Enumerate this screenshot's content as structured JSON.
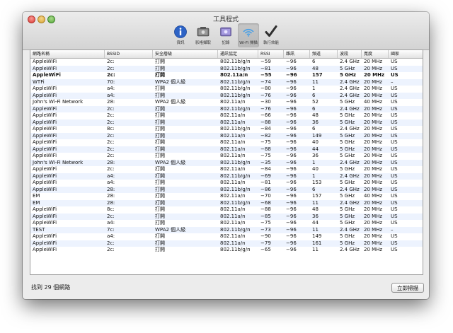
{
  "window": {
    "title": "工具程式"
  },
  "toolbar": {
    "items": [
      {
        "key": "info",
        "label": "資訊",
        "icon": "info-icon"
      },
      {
        "key": "sniffer",
        "label": "影格擷取",
        "icon": "frame-capture-icon"
      },
      {
        "key": "log",
        "label": "記錄",
        "icon": "log-icon"
      },
      {
        "key": "scan",
        "label": "Wi-Fi 掃描",
        "icon": "wifi-scan-icon",
        "selected": true
      },
      {
        "key": "performance",
        "label": "執行效能",
        "icon": "performance-check-icon"
      }
    ]
  },
  "table": {
    "columns": [
      "網路名稱",
      "BSSID",
      "安全層級",
      "通訊協定",
      "RSSI",
      "雜訊",
      "頻道",
      "波段",
      "寬度",
      "國家"
    ],
    "rows": [
      [
        "AppleWiFi",
        "2c:",
        "打開",
        "802.11b/g/n",
        "−59",
        "−96",
        "6",
        "2.4 GHz",
        "20 MHz",
        "US"
      ],
      [
        "AppleWiFi",
        "2c:",
        "打開",
        "802.11b/g/n",
        "−81",
        "−96",
        "48",
        "5 GHz",
        "20 MHz",
        "US"
      ],
      [
        "AppleWiFi",
        "2c:",
        "打開",
        "802.11a/n",
        "−55",
        "−96",
        "157",
        "5 GHz",
        "20 MHz",
        "US"
      ],
      [
        "WTFi",
        "70:",
        "WPA2 個人級",
        "802.11b/g/n",
        "−74",
        "−96",
        "11",
        "2.4 GHz",
        "20 MHz",
        "–"
      ],
      [
        "AppleWiFi",
        "a4:",
        "打開",
        "802.11b/g/n",
        "−80",
        "−96",
        "1",
        "2.4 GHz",
        "20 MHz",
        "US"
      ],
      [
        "AppleWiFi",
        "a4:",
        "打開",
        "802.11b/g/n",
        "−76",
        "−96",
        "6",
        "2.4 GHz",
        "20 MHz",
        "US"
      ],
      [
        "John's Wi-Fi Network",
        "28:",
        "WPA2 個人級",
        "802.11a/n",
        "−30",
        "−96",
        "52",
        "5 GHz",
        "40 MHz",
        "US"
      ],
      [
        "AppleWiFi",
        "2c:",
        "打開",
        "802.11b/g/n",
        "−76",
        "−96",
        "6",
        "2.4 GHz",
        "20 MHz",
        "US"
      ],
      [
        "AppleWiFi",
        "2c:",
        "打開",
        "802.11a/n",
        "−66",
        "−96",
        "48",
        "5 GHz",
        "20 MHz",
        "US"
      ],
      [
        "AppleWiFi",
        "2c:",
        "打開",
        "802.11a/n",
        "−88",
        "−96",
        "36",
        "5 GHz",
        "20 MHz",
        "US"
      ],
      [
        "AppleWiFi",
        "8c:",
        "打開",
        "802.11b/g/n",
        "−84",
        "−96",
        "6",
        "2.4 GHz",
        "20 MHz",
        "US"
      ],
      [
        "AppleWiFi",
        "2c:",
        "打開",
        "802.11a/n",
        "−82",
        "−96",
        "149",
        "5 GHz",
        "20 MHz",
        "US"
      ],
      [
        "AppleWiFi",
        "2c:",
        "打開",
        "802.11a/n",
        "−75",
        "−96",
        "40",
        "5 GHz",
        "20 MHz",
        "US"
      ],
      [
        "AppleWiFi",
        "2c:",
        "打開",
        "802.11a/n",
        "−88",
        "−96",
        "44",
        "5 GHz",
        "20 MHz",
        "US"
      ],
      [
        "AppleWiFi",
        "2c:",
        "打開",
        "802.11a/n",
        "−75",
        "−96",
        "36",
        "5 GHz",
        "20 MHz",
        "US"
      ],
      [
        "John's Wi-Fi Network",
        "28:",
        "WPA2 個人級",
        "802.11b/g/n",
        "−35",
        "−96",
        "1",
        "2.4 GHz",
        "20 MHz",
        "US"
      ],
      [
        "AppleWiFi",
        "2c:",
        "打開",
        "802.11a/n",
        "−84",
        "−96",
        "40",
        "5 GHz",
        "20 MHz",
        "US"
      ],
      [
        "AppleWiFi",
        "a4:",
        "打開",
        "802.11b/g/n",
        "−69",
        "−96",
        "1",
        "2.4 GHz",
        "20 MHz",
        "US"
      ],
      [
        "AppleWiFi",
        "a4:",
        "打開",
        "802.11a/n",
        "−81",
        "−96",
        "153",
        "5 GHz",
        "20 MHz",
        "US"
      ],
      [
        "AppleWiFi",
        "28:",
        "打開",
        "802.11b/g/n",
        "−86",
        "−96",
        "6",
        "2.4 GHz",
        "20 MHz",
        "US"
      ],
      [
        "EM",
        "28:",
        "打開",
        "802.11a/n",
        "−70",
        "−96",
        "157",
        "5 GHz",
        "40 MHz",
        "US"
      ],
      [
        "EM",
        "28:",
        "打開",
        "802.11b/g/n",
        "−68",
        "−96",
        "11",
        "2.4 GHz",
        "20 MHz",
        "US"
      ],
      [
        "AppleWiFi",
        "8c:",
        "打開",
        "802.11a/n",
        "−88",
        "−96",
        "48",
        "5 GHz",
        "20 MHz",
        "US"
      ],
      [
        "AppleWiFi",
        "2c:",
        "打開",
        "802.11a/n",
        "−85",
        "−96",
        "36",
        "5 GHz",
        "20 MHz",
        "US"
      ],
      [
        "AppleWiFi",
        "a4:",
        "打開",
        "802.11a/n",
        "−75",
        "−96",
        "44",
        "5 GHz",
        "20 MHz",
        "US"
      ],
      [
        "TEST",
        "7c:",
        "WPA2 個人級",
        "802.11b/g/n",
        "−73",
        "−96",
        "11",
        "2.4 GHz",
        "20 MHz",
        "–"
      ],
      [
        "AppleWiFi",
        "a4:",
        "打開",
        "802.11a/n",
        "−90",
        "−96",
        "149",
        "5 GHz",
        "20 MHz",
        "US"
      ],
      [
        "AppleWiFi",
        "2c:",
        "打開",
        "802.11a/n",
        "−79",
        "−96",
        "161",
        "5 GHz",
        "20 MHz",
        "US"
      ],
      [
        "AppleWiFi",
        "2c:",
        "打開",
        "802.11b/g/n",
        "−65",
        "−96",
        "11",
        "2.4 GHz",
        "20 MHz",
        "US"
      ]
    ],
    "bold_row_index": 2
  },
  "footer": {
    "status": "找到 29 個網路",
    "rescan_label": "立即掃描"
  },
  "colors": {
    "alt_row": "#edf3fe",
    "info_icon": "#2d63c6",
    "scan_icon": "#4aa0e6"
  }
}
